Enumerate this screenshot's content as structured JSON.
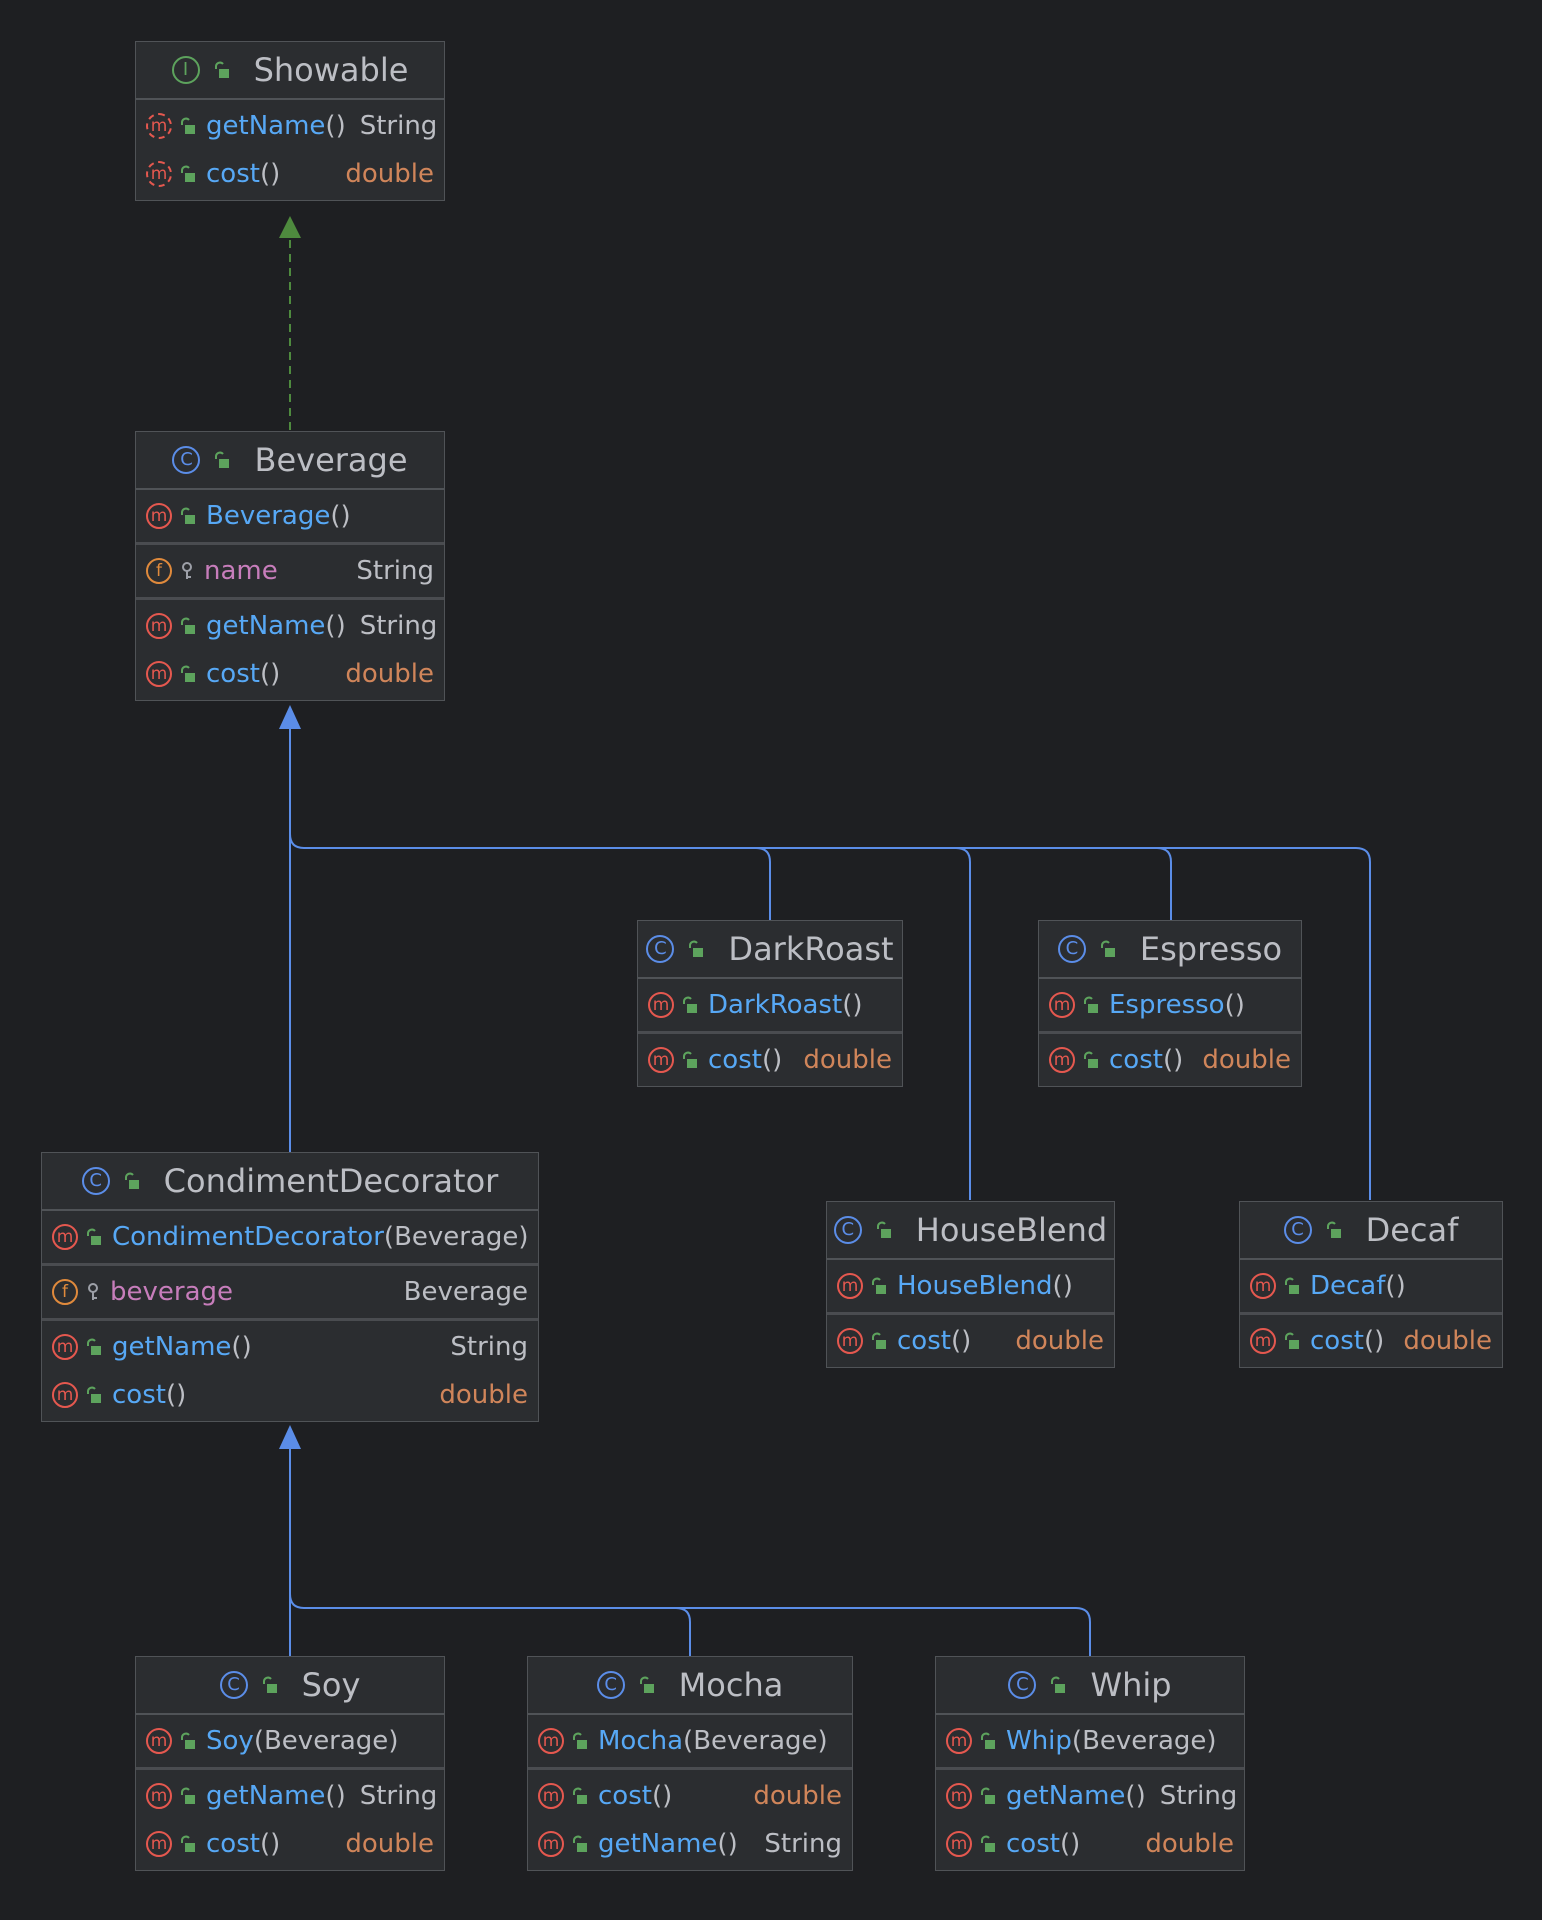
{
  "colors": {
    "background": "#1e1f22",
    "node_fill": "#2b2d30",
    "inheritance_edge": "#5b8de8",
    "implements_edge": "#4e8a3e",
    "method_name": "#57a8f5",
    "field_name": "#c77dbb",
    "type_double": "#d0855a",
    "type_ref": "#bcbec4",
    "method_icon": "#e5584f",
    "field_icon": "#e08a3c",
    "class_icon": "#5b8de8",
    "interface_icon": "#5da35d"
  },
  "nodes": {
    "showable": {
      "kind": "interface",
      "kind_icon": "interface-icon",
      "kind_glyph": "I",
      "name": "Showable",
      "sections": [
        [
          {
            "kind": "method",
            "abstract": true,
            "name": "getName",
            "params": "",
            "type": "String"
          },
          {
            "kind": "method",
            "abstract": true,
            "name": "cost",
            "params": "",
            "type": "double"
          }
        ]
      ]
    },
    "beverage": {
      "kind": "class",
      "kind_icon": "class-icon",
      "kind_glyph": "C",
      "name": "Beverage",
      "sections": [
        [
          {
            "kind": "constructor",
            "name": "Beverage",
            "params": "",
            "type": ""
          }
        ],
        [
          {
            "kind": "field",
            "name": "name",
            "type": "String",
            "visibility": "protected"
          }
        ],
        [
          {
            "kind": "method",
            "name": "getName",
            "params": "",
            "type": "String"
          },
          {
            "kind": "method",
            "name": "cost",
            "params": "",
            "type": "double"
          }
        ]
      ]
    },
    "darkroast": {
      "kind": "class",
      "kind_icon": "class-icon",
      "kind_glyph": "C",
      "name": "DarkRoast",
      "sections": [
        [
          {
            "kind": "constructor",
            "name": "DarkRoast",
            "params": "",
            "type": ""
          }
        ],
        [
          {
            "kind": "method",
            "name": "cost",
            "params": "",
            "type": "double"
          }
        ]
      ]
    },
    "espresso": {
      "kind": "class",
      "kind_icon": "class-icon",
      "kind_glyph": "C",
      "name": "Espresso",
      "sections": [
        [
          {
            "kind": "constructor",
            "name": "Espresso",
            "params": "",
            "type": ""
          }
        ],
        [
          {
            "kind": "method",
            "name": "cost",
            "params": "",
            "type": "double"
          }
        ]
      ]
    },
    "condimentdecorator": {
      "kind": "class",
      "kind_icon": "class-icon",
      "kind_glyph": "C",
      "name": "CondimentDecorator",
      "sections": [
        [
          {
            "kind": "constructor",
            "name": "CondimentDecorator",
            "params": "Beverage",
            "type": ""
          }
        ],
        [
          {
            "kind": "field",
            "name": "beverage",
            "type": "Beverage",
            "visibility": "protected"
          }
        ],
        [
          {
            "kind": "method",
            "name": "getName",
            "params": "",
            "type": "String"
          },
          {
            "kind": "method",
            "name": "cost",
            "params": "",
            "type": "double"
          }
        ]
      ]
    },
    "houseblend": {
      "kind": "class",
      "kind_icon": "class-icon",
      "kind_glyph": "C",
      "name": "HouseBlend",
      "sections": [
        [
          {
            "kind": "constructor",
            "name": "HouseBlend",
            "params": "",
            "type": ""
          }
        ],
        [
          {
            "kind": "method",
            "name": "cost",
            "params": "",
            "type": "double"
          }
        ]
      ]
    },
    "decaf": {
      "kind": "class",
      "kind_icon": "class-icon",
      "kind_glyph": "C",
      "name": "Decaf",
      "sections": [
        [
          {
            "kind": "constructor",
            "name": "Decaf",
            "params": "",
            "type": ""
          }
        ],
        [
          {
            "kind": "method",
            "name": "cost",
            "params": "",
            "type": "double"
          }
        ]
      ]
    },
    "soy": {
      "kind": "class",
      "kind_icon": "class-icon",
      "kind_glyph": "C",
      "name": "Soy",
      "sections": [
        [
          {
            "kind": "constructor",
            "name": "Soy",
            "params": "Beverage",
            "type": ""
          }
        ],
        [
          {
            "kind": "method",
            "name": "getName",
            "params": "",
            "type": "String"
          },
          {
            "kind": "method",
            "name": "cost",
            "params": "",
            "type": "double"
          }
        ]
      ]
    },
    "mocha": {
      "kind": "class",
      "kind_icon": "class-icon",
      "kind_glyph": "C",
      "name": "Mocha",
      "sections": [
        [
          {
            "kind": "constructor",
            "name": "Mocha",
            "params": "Beverage",
            "type": ""
          }
        ],
        [
          {
            "kind": "method",
            "name": "cost",
            "params": "",
            "type": "double"
          },
          {
            "kind": "method",
            "name": "getName",
            "params": "",
            "type": "String"
          }
        ]
      ]
    },
    "whip": {
      "kind": "class",
      "kind_icon": "class-icon",
      "kind_glyph": "C",
      "name": "Whip",
      "sections": [
        [
          {
            "kind": "constructor",
            "name": "Whip",
            "params": "Beverage",
            "type": ""
          }
        ],
        [
          {
            "kind": "method",
            "name": "getName",
            "params": "",
            "type": "String"
          },
          {
            "kind": "method",
            "name": "cost",
            "params": "",
            "type": "double"
          }
        ]
      ]
    }
  },
  "edges": [
    {
      "from": "beverage",
      "to": "showable",
      "type": "implements"
    },
    {
      "from": "condimentdecorator",
      "to": "beverage",
      "type": "extends"
    },
    {
      "from": "darkroast",
      "to": "beverage",
      "type": "extends"
    },
    {
      "from": "houseblend",
      "to": "beverage",
      "type": "extends"
    },
    {
      "from": "espresso",
      "to": "beverage",
      "type": "extends"
    },
    {
      "from": "decaf",
      "to": "beverage",
      "type": "extends"
    },
    {
      "from": "soy",
      "to": "condimentdecorator",
      "type": "extends"
    },
    {
      "from": "mocha",
      "to": "condimentdecorator",
      "type": "extends"
    },
    {
      "from": "whip",
      "to": "condimentdecorator",
      "type": "extends"
    }
  ]
}
